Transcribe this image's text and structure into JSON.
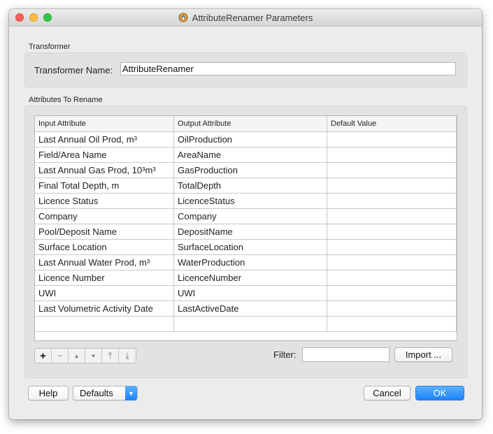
{
  "window": {
    "title": "AttributeRenamer Parameters"
  },
  "transformer_group": {
    "label": "Transformer",
    "name_label": "Transformer Name:",
    "name_value": "AttributeRenamer"
  },
  "attributes_group": {
    "label": "Attributes To Rename",
    "columns": [
      "Input Attribute",
      "Output Attribute",
      "Default Value"
    ],
    "rows": [
      [
        "Last Annual Oil Prod, m³",
        "OilProduction",
        ""
      ],
      [
        "Field/Area Name",
        "AreaName",
        ""
      ],
      [
        "Last Annual Gas Prod, 10³m³",
        "GasProduction",
        ""
      ],
      [
        "Final Total Depth, m",
        "TotalDepth",
        ""
      ],
      [
        "Licence Status",
        "LicenceStatus",
        ""
      ],
      [
        "Company",
        "Company",
        ""
      ],
      [
        "Pool/Deposit Name",
        "DepositName",
        ""
      ],
      [
        "Surface Location",
        "SurfaceLocation",
        ""
      ],
      [
        "Last Annual Water Prod, m³",
        "WaterProduction",
        ""
      ],
      [
        "Licence Number",
        "LicenceNumber",
        ""
      ],
      [
        "UWI",
        "UWI",
        ""
      ],
      [
        "Last Volumetric Activity Date",
        "LastActiveDate",
        ""
      ],
      [
        "",
        "",
        ""
      ]
    ],
    "toolbar": {
      "add": "+",
      "remove": "−",
      "move_up": "▲",
      "move_down": "▼",
      "move_top": "⤒",
      "move_bottom": "⤓"
    },
    "filter_label": "Filter:",
    "filter_value": "",
    "import_label": "Import ..."
  },
  "footer": {
    "help_label": "Help",
    "defaults_label": "Defaults",
    "cancel_label": "Cancel",
    "ok_label": "OK"
  },
  "colors": {
    "accent": "#1a82fb",
    "close": "#fc605c",
    "minimize": "#fdbc40",
    "zoom": "#34c84a"
  }
}
